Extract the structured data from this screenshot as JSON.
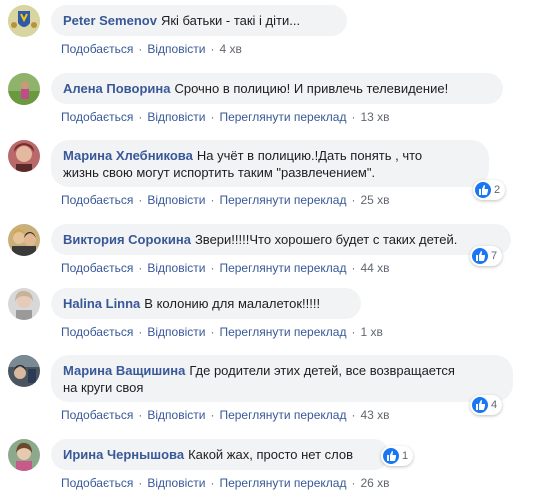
{
  "actions": {
    "like": "Подобається",
    "reply": "Відповісти",
    "translate": "Переглянути переклад"
  },
  "comments": [
    {
      "author": "Peter Semenov",
      "text": "Які батьки - такі і діти...",
      "time": "4 хв",
      "reactions": null
    },
    {
      "author": "Алена Поворина",
      "text": "Срочно в полицию! И привлечь телевидение!",
      "time": "13 хв",
      "reactions": null
    },
    {
      "author": "Марина Хлебникова",
      "text_line1": "На учёт в полицию.!Дать понять , что",
      "text_line2": "жизнь свою могут испортить таким \"развлечением\".",
      "time": "25 хв",
      "reactions": "2"
    },
    {
      "author": "Виктория Сорокина",
      "text": "Звери!!!!!Что хорошего будет с таких детей.",
      "time": "44 хв",
      "reactions": "7"
    },
    {
      "author": "Halina Linna",
      "text": "В колонию для малалеток!!!!!",
      "time": "1 хв",
      "reactions": null
    },
    {
      "author": "Марина Ващишина",
      "text_line1": "Где родители этих детей, все возвращается",
      "text_line2": "на круги своя",
      "time": "43 хв",
      "reactions": "4"
    },
    {
      "author": "Ирина Чернышова",
      "text": "Какой жах, просто нет слов",
      "time": "26 хв",
      "reactions": "1"
    }
  ],
  "colors": {
    "name": "#385898",
    "bubble": "#f2f3f5",
    "like": "#1877f2",
    "meta": "#616770"
  }
}
